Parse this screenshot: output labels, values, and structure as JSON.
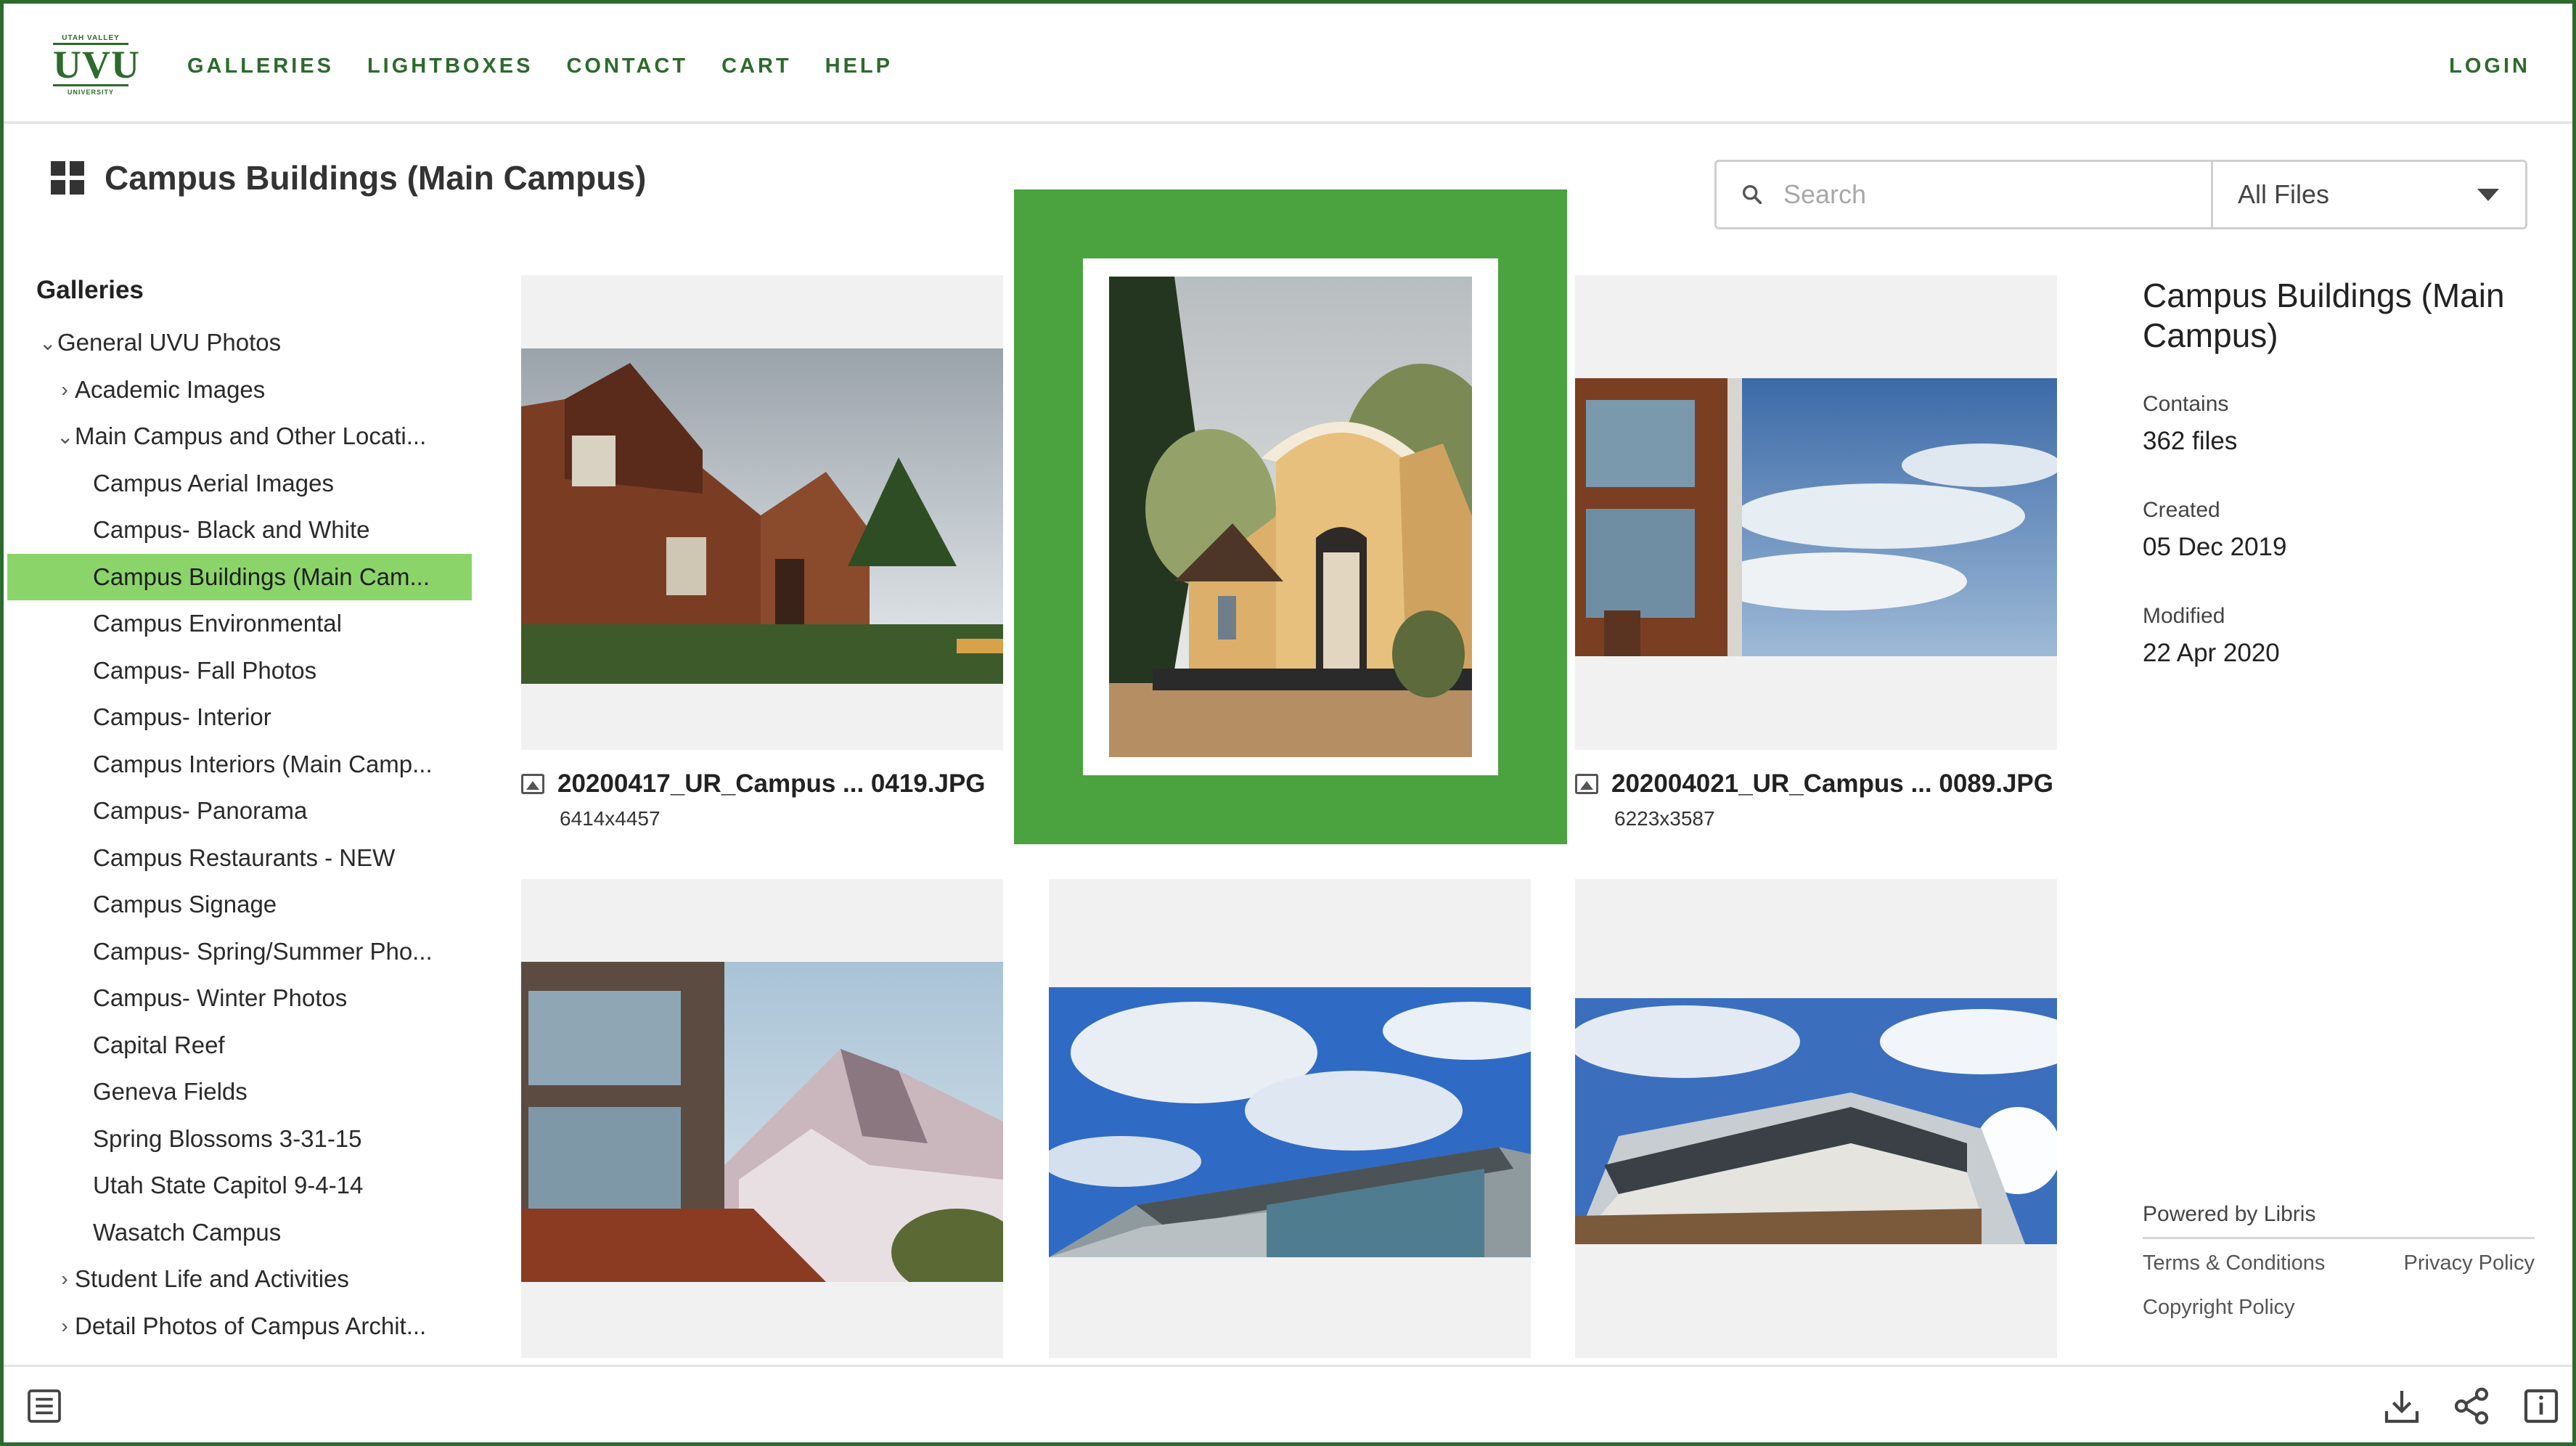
{
  "header": {
    "logo_top": "UTAH VALLEY",
    "logo_mark": "UVU",
    "logo_bottom": "UNIVERSITY",
    "nav": [
      "GALLERIES",
      "LIGHTBOXES",
      "CONTACT",
      "CART",
      "HELP"
    ],
    "login": "LOGIN"
  },
  "page_title": "Campus Buildings (Main Campus)",
  "search": {
    "placeholder": "Search",
    "filter_value": "All Files"
  },
  "sidebar": {
    "heading": "Galleries",
    "items": [
      {
        "label": "General UVU Photos",
        "chevron": "⌄"
      },
      {
        "label": "Academic Images",
        "chevron": "›"
      },
      {
        "label": "Main Campus and Other Locati...",
        "chevron": "⌄"
      },
      {
        "label": "Campus Aerial Images"
      },
      {
        "label": "Campus- Black and White"
      },
      {
        "label": "Campus Buildings (Main Cam..."
      },
      {
        "label": "Campus Environmental"
      },
      {
        "label": "Campus- Fall Photos"
      },
      {
        "label": "Campus- Interior"
      },
      {
        "label": "Campus Interiors (Main Camp..."
      },
      {
        "label": "Campus- Panorama"
      },
      {
        "label": "Campus Restaurants - NEW"
      },
      {
        "label": "Campus Signage"
      },
      {
        "label": "Campus- Spring/Summer Pho..."
      },
      {
        "label": "Campus- Winter Photos"
      },
      {
        "label": "Capital Reef"
      },
      {
        "label": "Geneva Fields"
      },
      {
        "label": "Spring Blossoms 3-31-15"
      },
      {
        "label": "Utah State Capitol 9-4-14"
      },
      {
        "label": "Wasatch Campus"
      },
      {
        "label": "Student Life and Activities",
        "chevron": "›"
      },
      {
        "label": "Detail Photos of Campus Archit...",
        "chevron": "›"
      }
    ]
  },
  "grid": {
    "items": [
      {
        "filename": "20200417_UR_Campus ... 0419.JPG",
        "dimensions": "6414x4457"
      },
      {
        "filename": "",
        "dimensions": ""
      },
      {
        "filename": "202004021_UR_Campus ... 0089.JPG",
        "dimensions": "6223x3587"
      }
    ]
  },
  "info": {
    "title": "Campus Buildings (Main Campus)",
    "contains_label": "Contains",
    "contains_value": "362 files",
    "created_label": "Created",
    "created_value": "05 Dec 2019",
    "modified_label": "Modified",
    "modified_value": "22 Apr 2020"
  },
  "footer": {
    "powered_by": "Powered by Libris",
    "terms": "Terms & Conditions",
    "privacy": "Privacy Policy",
    "copyright": "Copyright Policy"
  },
  "colors": {
    "brand_green": "#2d6a2d",
    "selection_green": "#4aa33f",
    "active_sidebar": "#8bd46a"
  },
  "icons": {
    "list": "list-icon",
    "download": "download-icon",
    "share": "share-icon",
    "info": "info-icon",
    "search": "search-icon",
    "grid": "grid-icon"
  }
}
